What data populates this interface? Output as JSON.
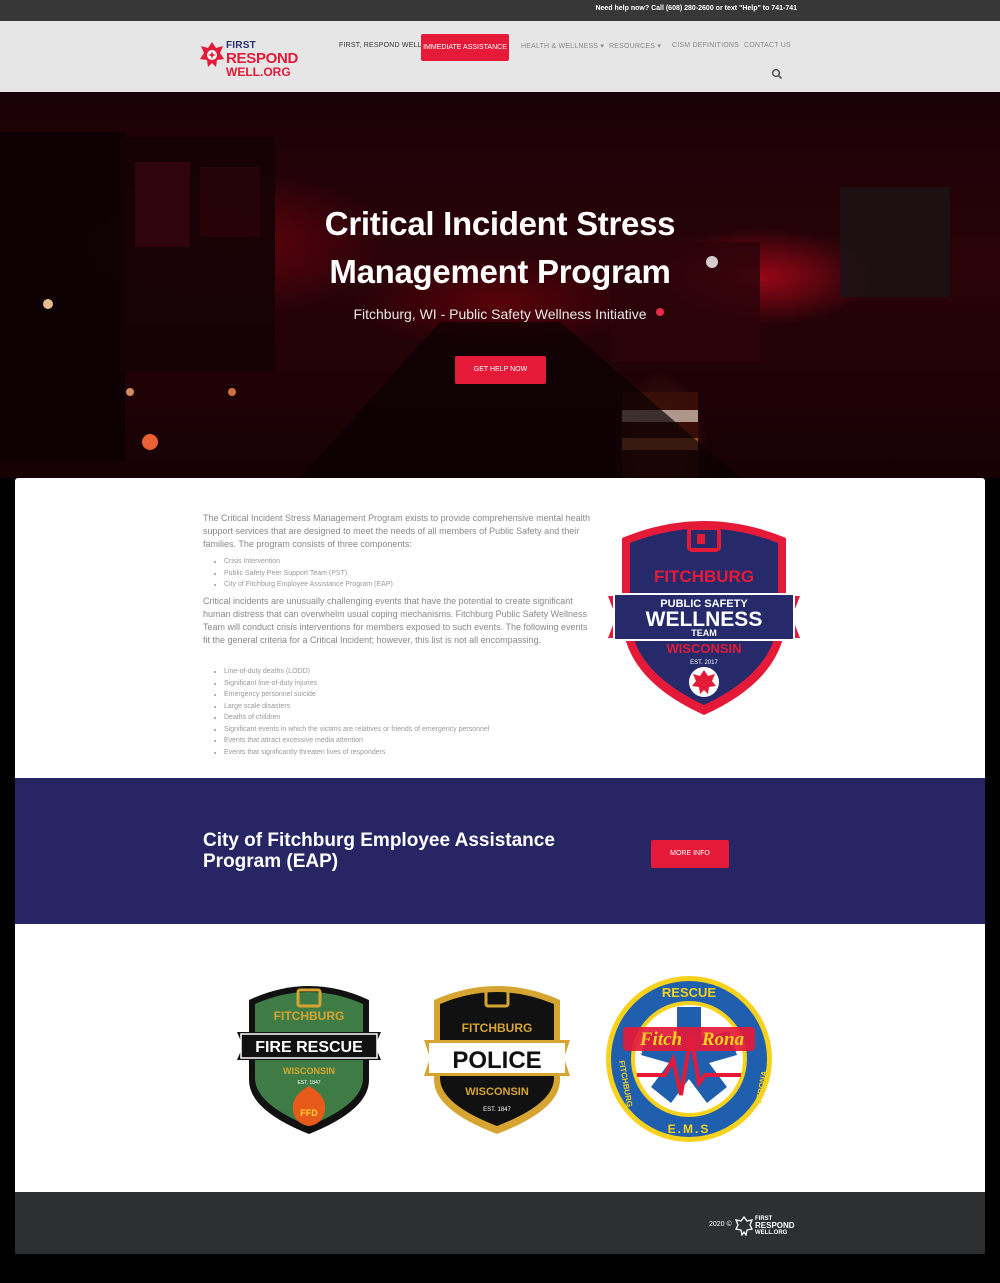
{
  "topbar": {
    "help_text": "Need help now? Call (608) 280-2600 or text \"Help\" to 741-741"
  },
  "logo": {
    "line1": "FIRST",
    "line2": "RESPOND",
    "line3": "WELL.ORG"
  },
  "nav": {
    "items": [
      {
        "label": "FIRST, RESPOND WELL"
      },
      {
        "label": "IMMEDIATE ASSISTANCE"
      },
      {
        "label": "HEALTH & WELLNESS"
      },
      {
        "label": "RESOURCES"
      },
      {
        "label": "CISM DEFINITIONS"
      },
      {
        "label": "CONTACT US"
      }
    ],
    "search_icon": "search-icon",
    "accent_color": "#e41a38"
  },
  "hero": {
    "title_line1": "Critical Incident Stress",
    "title_line2": "Management Program",
    "subtitle": "Fitchburg, WI - Public Safety Wellness Initiative",
    "cta": "GET HELP NOW"
  },
  "intro": {
    "paragraph1": "The Critical Incident Stress Management Program exists to provide comprehensive mental health support services that are designed to meet the needs of all members of Public Safety and their families. The program consists of three components:",
    "components": [
      "Crisis Intervention",
      "Public Safety Peer Support Team (PST)",
      "City of Fitchburg Employee Assistance Program (EAP)"
    ],
    "paragraph2": "Critical incidents are unusually challenging events that have the potential to create significant human distress that can overwhelm usual coping mechanisms. Fitchburg Public Safety Wellness Team will conduct crisis interventions for members exposed to such events. The following events fit the general criteria for a Critical Incident; however, this list is not all encompassing.",
    "events": [
      "Line-of-duty deaths (LODD)",
      "Significant line-of-duty injuries",
      "Emergency personnel suicide",
      "Large scale disasters",
      "Deaths of children",
      "Significant events in which the victims are relatives or friends of emergency personnel",
      "Events that attract excessive media attention",
      "Events that significantly threaten lives of responders"
    ]
  },
  "wellness_badge": {
    "top": "FITCHBURG",
    "mid1": "PUBLIC SAFETY",
    "mid2": "WELLNESS",
    "mid3": "TEAM",
    "est": "EST. 2017",
    "bottom": "WISCONSIN",
    "colors": {
      "navy": "#262a6b",
      "red": "#e41a38"
    }
  },
  "eap": {
    "title_line1": "City of Fitchburg Employee Assistance",
    "title_line2": "Program (EAP)",
    "button": "MORE INFO",
    "bg_color": "#272564"
  },
  "badges": {
    "fire": {
      "top": "FITCHBURG",
      "main": "FIRE RESCUE",
      "state": "WISCONSIN",
      "est": "EST. 1847",
      "mark": "FFD"
    },
    "police": {
      "top": "FITCHBURG",
      "main": "POLICE",
      "state": "WISCONSIN",
      "est": "EST. 1847"
    },
    "ems": {
      "top": "RESCUE",
      "main1": "Fitch",
      "main2": "Rona",
      "left": "FITCHBURG",
      "bottom": "E.M.S",
      "right": "VERONA"
    }
  },
  "footer": {
    "copyright": "2020 ©",
    "logo_line1": "FIRST",
    "logo_line2": "RESPOND",
    "logo_line3": "WELL.ORG"
  }
}
